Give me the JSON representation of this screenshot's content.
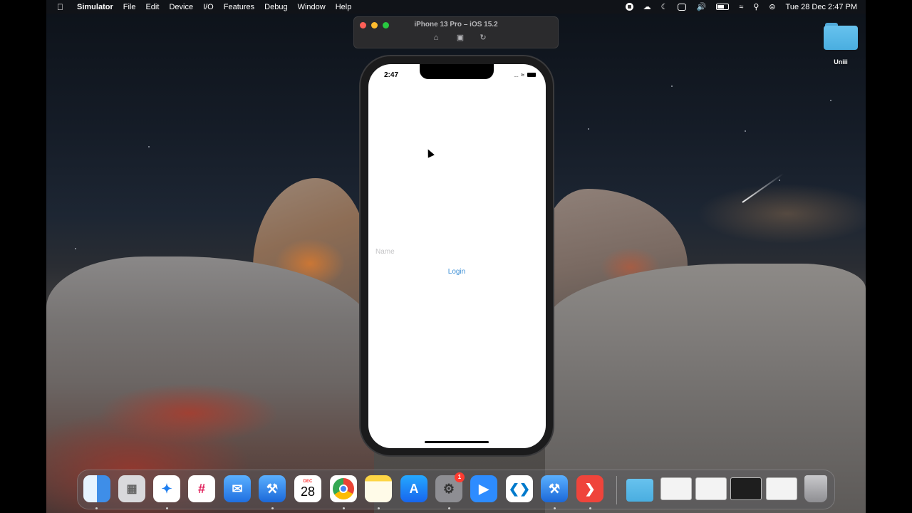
{
  "menubar": {
    "apple_icon": "apple-logo",
    "app_name": "Simulator",
    "menus": [
      "File",
      "Edit",
      "Device",
      "I/O",
      "Features",
      "Debug",
      "Window",
      "Help"
    ],
    "clock": "Tue 28 Dec  2:47 PM"
  },
  "simulator": {
    "title": "iPhone 13 Pro – iOS 15.2",
    "toolbar_icons": [
      "home-icon",
      "screenshot-icon",
      "rotate-icon"
    ]
  },
  "phone": {
    "status_time": "2:47",
    "name_placeholder": "Name",
    "name_value": "",
    "login_label": "Login"
  },
  "desktop": {
    "folder_label": "Uniii"
  },
  "dock": {
    "calendar_month": "DEC",
    "calendar_day": "28",
    "settings_badge": "1",
    "apps": [
      "Finder",
      "Launchpad",
      "Safari",
      "Slack",
      "Mail",
      "Xcode",
      "Calendar",
      "Chrome",
      "Notes",
      "App Store",
      "System Preferences",
      "Zoom",
      "Visual Studio Code",
      "Simulator",
      "AnyDesk"
    ]
  },
  "colors": {
    "accent_link": "#3d8fd6",
    "traffic_red": "#fe5f57",
    "traffic_yellow": "#febc2e",
    "traffic_green": "#28c840"
  }
}
